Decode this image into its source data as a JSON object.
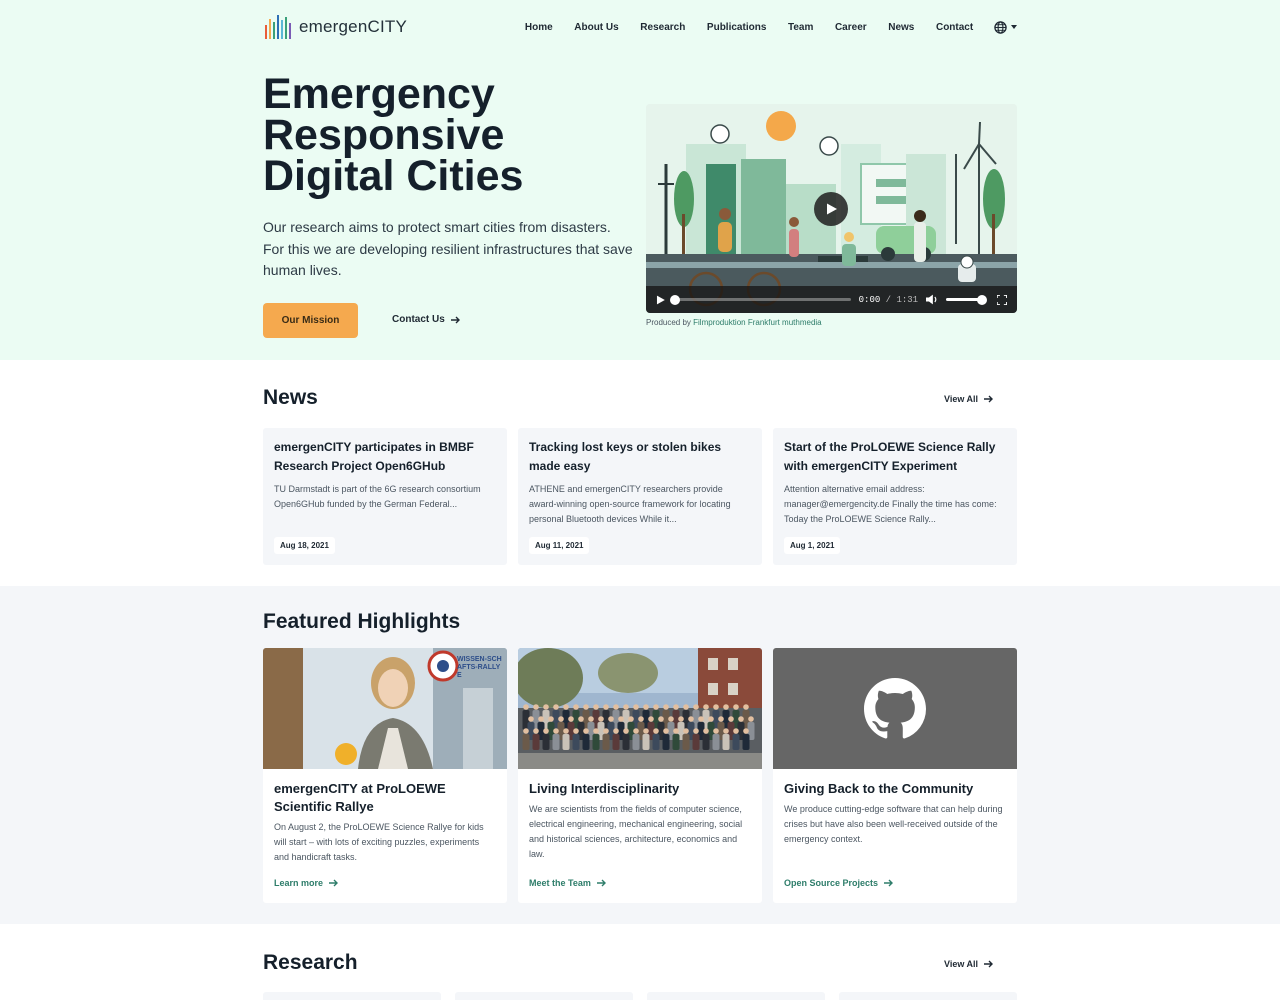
{
  "brand": {
    "name": "emergenCITY"
  },
  "nav": {
    "items": [
      "Home",
      "About Us",
      "Research",
      "Publications",
      "Team",
      "Career",
      "News",
      "Contact"
    ],
    "language_icon": "globe-icon"
  },
  "hero": {
    "title": "Emergency Responsive Digital Cities",
    "text": "Our research aims to protect smart cities from disasters. For this we are developing resilient infrastructures that save human lives.",
    "primary_button": "Our Mission",
    "secondary_link": "Contact Us"
  },
  "video": {
    "current_time": "0:00",
    "separator": " / ",
    "duration": "1:31",
    "progress": 0,
    "volume": 1.0,
    "credit_prefix": "Produced by ",
    "credit_link": "Filmproduktion Frankfurt muthmedia"
  },
  "news": {
    "title": "News",
    "view_all": "View All",
    "items": [
      {
        "title": "emergenCITY participates in BMBF Research Project Open6GHub",
        "excerpt": "TU Darmstadt is part of the 6G research consortium Open6GHub funded by the German Federal...",
        "date": "Aug 18, 2021"
      },
      {
        "title": "Tracking lost keys or stolen bikes made easy",
        "excerpt": "ATHENE and emergenCITY researchers provide award-winning open-source framework for locating personal Bluetooth devices While it...",
        "date": "Aug 11, 2021"
      },
      {
        "title": "Start of the ProLOEWE Science Rally with emergenCITY Experiment",
        "excerpt": "Attention alternative email address: manager@emergencity.de Finally the time has come: Today the ProLOEWE Science Rally...",
        "date": "Aug 1, 2021"
      }
    ]
  },
  "highlights": {
    "title": "Featured Highlights",
    "items": [
      {
        "title": "emergenCITY at ProLOEWE Scientific Rallye",
        "text": "On August 2, the ProLOEWE Science Rallye for kids will start – with lots of exciting puzzles, experiments and handicraft tasks.",
        "link": "Learn more",
        "image_badge": "WISSEN-SCHAFTS-RALLYE"
      },
      {
        "title": "Living Interdisciplinarity",
        "text": "We are scientists from the fields of computer science, electrical engineering, mechanical engineering, social and historical sciences, architecture, economics and law.",
        "link": "Meet the Team"
      },
      {
        "title": "Giving Back to the Community",
        "text": "We produce cutting-edge software that can help during crises but have also been well-received outside of the emergency context.",
        "link": "Open Source Projects",
        "image_icon": "github-icon"
      }
    ]
  },
  "research": {
    "title": "Research",
    "view_all": "View All"
  },
  "colors": {
    "hero_bg": "#ebfcf3",
    "accent": "#f5a94e",
    "link_green": "#2e7d6a",
    "card_bg": "#f4f6f9"
  }
}
